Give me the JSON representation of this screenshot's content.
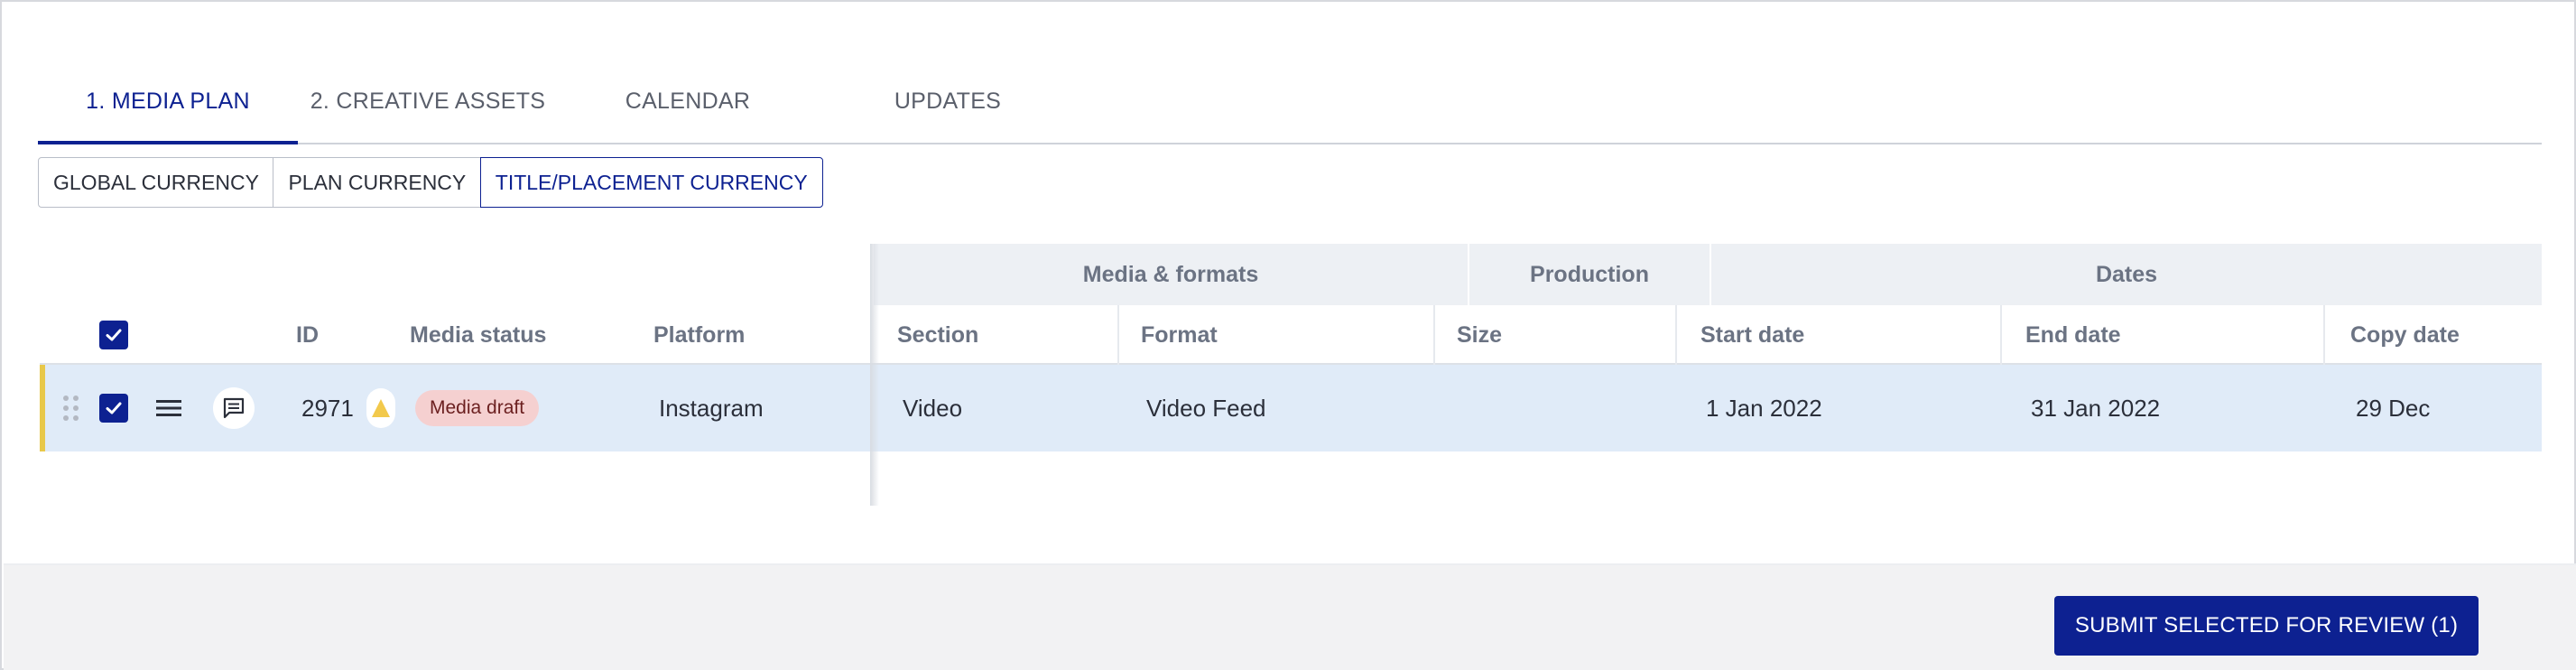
{
  "tabs": [
    {
      "label": "1. MEDIA PLAN",
      "active": true
    },
    {
      "label": "2. CREATIVE ASSETS",
      "active": false
    },
    {
      "label": "CALENDAR",
      "active": false
    },
    {
      "label": "UPDATES",
      "active": false
    }
  ],
  "currency": {
    "options": [
      "GLOBAL CURRENCY",
      "PLAN CURRENCY",
      "TITLE/PLACEMENT CURRENCY"
    ],
    "selected": "TITLE/PLACEMENT CURRENCY"
  },
  "table": {
    "groups": [
      "Media & formats",
      "Production",
      "Dates"
    ],
    "columns": [
      "ID",
      "Media status",
      "Platform",
      "Section",
      "Format",
      "Size",
      "Start date",
      "End date",
      "Copy date"
    ],
    "rows": [
      {
        "selected": true,
        "id": "2971",
        "status": "Media draft",
        "platform": "Instagram",
        "section": "Video",
        "format": "Video Feed",
        "size": "",
        "start_date": "1 Jan 2022",
        "end_date": "31 Jan 2022",
        "copy_date": "29 Dec"
      }
    ]
  },
  "footer": {
    "submit_label": "SUBMIT SELECTED FOR REVIEW (1)"
  },
  "colors": {
    "primary": "#0d2191",
    "row_highlight": "#e0ebf8",
    "row_marker": "#e8c84a",
    "badge_bg": "#f5d0d0",
    "header_bg": "#edf0f4"
  },
  "icons": [
    "checkbox-checked-icon",
    "drag-handle-icon",
    "menu-icon",
    "comment-icon",
    "warning-icon"
  ]
}
